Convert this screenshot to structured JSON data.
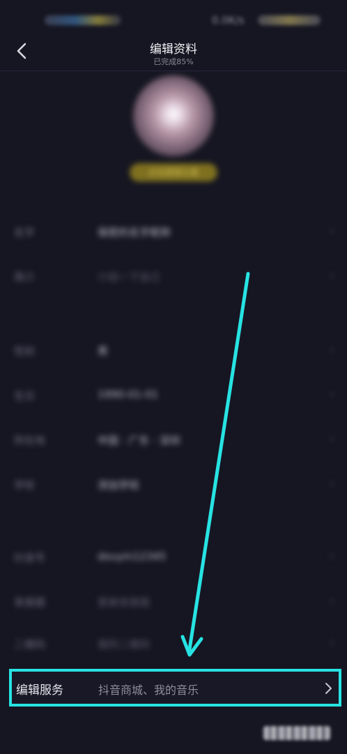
{
  "status_bar": {
    "right_text": "0.0K/s"
  },
  "header": {
    "title": "编辑资料",
    "subtitle": "已完成85%"
  },
  "avatar": {
    "badge": "点击更换头像"
  },
  "fields": [
    {
      "label": "名字",
      "value": "保密的名字昵称"
    },
    {
      "label": "简介",
      "value": "介绍一下自己"
    },
    {
      "label": "性别",
      "value": "男"
    },
    {
      "label": "生日",
      "value": "1990-01-01"
    },
    {
      "label": "所在地",
      "value": "中国 · 广东 · 深圳"
    },
    {
      "label": "学校",
      "value": "添加学校"
    },
    {
      "label": "抖音号",
      "value": "douyin12345"
    },
    {
      "label": "背景图",
      "value": "更换背景图"
    },
    {
      "label": "二维码",
      "value": "我的二维码"
    }
  ],
  "service": {
    "label": "编辑服务",
    "value": "抖音商城、我的音乐"
  },
  "watermark": {
    "text": "百度经验"
  },
  "colors": {
    "background": "#161622",
    "highlight": "#27e3e3",
    "arrow": "#27e3e3",
    "badge": "#e8d25a"
  },
  "icons": {
    "back": "chevron-left-icon",
    "row_chevron": "chevron-right-icon"
  }
}
